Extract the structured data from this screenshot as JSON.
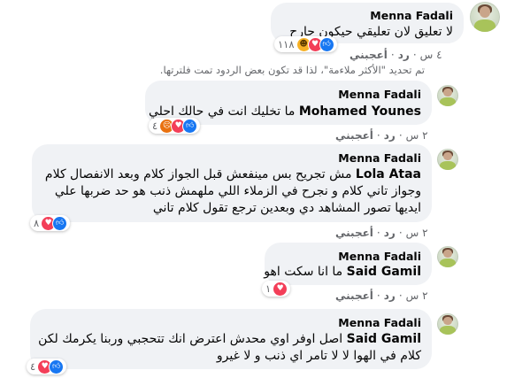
{
  "comments": [
    {
      "author": "Menna Fadali",
      "text": "لا تعليق لان تعليقي حيكون جارح",
      "reaction_count": "١١٨",
      "reactions": [
        "haha-icon",
        "love-icon",
        "like-icon"
      ],
      "time": "٤ س",
      "reply": "رد",
      "like": "أعجبني"
    },
    {
      "author": "Menna Fadali",
      "mention": "Mohamed Younes",
      "text": "ما تخليك انت في حالك احلي",
      "reaction_count": "٤",
      "reactions": [
        "like-icon",
        "love-icon",
        "angry-icon"
      ],
      "time": "٢ س",
      "reply": "رد",
      "like": "أعجبني"
    },
    {
      "author": "Menna Fadali",
      "mention": "Lola Ataa",
      "line1": "مش تجريح بس مينفعش قبل الجواز كلام وبعد الانفصال كلام",
      "line2": "وجواز تاني كلام و نجرح في الزملاء اللي ملهمش ذنب هو حد ضربها علي",
      "line3": "ايديها تصور المشاهد دي وبعدين ترجع تقول كلام تاني",
      "reaction_count": "٨",
      "reactions": [
        "like-icon",
        "love-icon"
      ],
      "time": "٢ س",
      "reply": "رد",
      "like": "أعجبني"
    },
    {
      "author": "Menna Fadali",
      "mention": "Said Gamil",
      "text": "ما انا سكت اهو",
      "reaction_count": "١",
      "reactions": [
        "love-icon"
      ],
      "time": "٢ س",
      "reply": "رد",
      "like": "أعجبني"
    },
    {
      "author": "Menna Fadali",
      "mention": "Said Gamil",
      "line1": "اصل اوفر اوي محدش اعترض انك تتحجبي وربنا يكرمك لكن",
      "line2": "كلام في الهوا لا لا تامر اي ذنب و لا غيرو",
      "reaction_count": "٤",
      "reactions": [
        "like-icon",
        "love-icon"
      ]
    }
  ],
  "filter_notice": "تم تحديد \"الأكثر ملاءمة\"، لذا قد تكون بعض الردود تمت فلترتها."
}
